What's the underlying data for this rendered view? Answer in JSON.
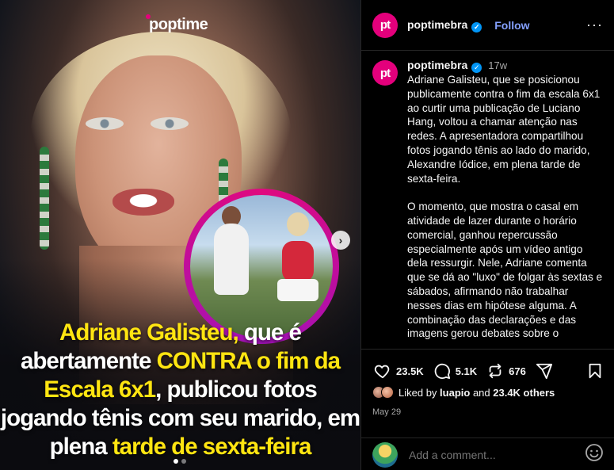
{
  "media": {
    "logo": "poptime",
    "headline": [
      {
        "t": "Adriane Galisteu,",
        "y": true
      },
      {
        "t": " que é abertamente ",
        "y": false
      },
      {
        "t": "CONTRA o fim da Escala 6x1",
        "y": true
      },
      {
        "t": ", publicou fotos jogando tênis com seu marido, em plena ",
        "y": false
      },
      {
        "t": "tarde de sexta-feira",
        "y": true
      }
    ],
    "next_icon": "chevron-right-icon",
    "carousel_total": 2,
    "carousel_active": 1
  },
  "header": {
    "avatar_text": "pt",
    "username": "poptimebra",
    "follow_label": "Follow",
    "more_icon": "more-options-icon"
  },
  "caption": {
    "username": "poptimebra",
    "time": "17w",
    "text": "Adriane Galisteu, que se posicionou publicamente contra o fim da escala 6x1 ao curtir uma publicação de Luciano Hang, voltou a chamar atenção nas redes. A apresentadora compartilhou fotos jogando tênis ao lado do marido, Alexandre Iódice, em plena tarde de sexta-feira.\n\nO momento, que mostra o casal em atividade de lazer durante o horário comercial, ganhou repercussão especialmente após um vídeo antigo dela ressurgir. Nele, Adriane comenta que se dá ao \"luxo\" de folgar às sextas e sábados, afirmando não trabalhar nesses dias em hipótese alguma. A combinação das declarações e das imagens gerou debates sobre o"
  },
  "actions": {
    "likes": "23.5K",
    "comments": "5.1K",
    "reposts": "676",
    "liked_by_prefix": "Liked by ",
    "liked_by_user": "luapio",
    "liked_by_and": " and ",
    "liked_by_others": "23.4K others",
    "date": "May 29"
  },
  "comment_box": {
    "placeholder": "Add a comment...",
    "emoji_icon": "emoji-icon"
  },
  "colors": {
    "brand": "#e4007c",
    "follow": "#85a1ff",
    "verified": "#0095f6",
    "headline_highlight": "#ffe511"
  }
}
